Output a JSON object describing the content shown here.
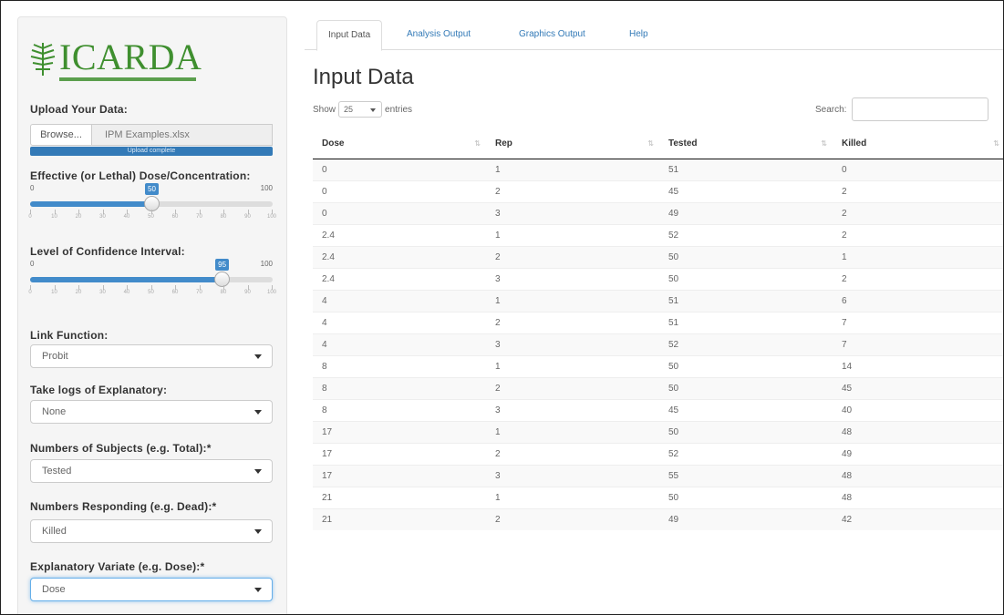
{
  "logo": {
    "text": "ICARDA"
  },
  "sidebar": {
    "upload_label": "Upload Your Data:",
    "browse_label": "Browse...",
    "file_name": "IPM Examples.xlsx",
    "upload_status": "Upload complete",
    "dose_label": "Effective (or Lethal) Dose/Concentration:",
    "dose_slider": {
      "min": "0",
      "max": "100",
      "value": "50",
      "value_fraction": 0.5,
      "tick_labels": [
        "0",
        "10",
        "20",
        "30",
        "40",
        "50",
        "60",
        "70",
        "80",
        "90",
        "100"
      ]
    },
    "ci_label": "Level of Confidence Interval:",
    "ci_slider": {
      "min": "0",
      "max": "100",
      "value": "95",
      "value_fraction": 0.79,
      "tick_labels": [
        "0",
        "10",
        "20",
        "30",
        "40",
        "50",
        "60",
        "70",
        "80",
        "90",
        "100"
      ]
    },
    "link_label": "Link Function:",
    "link_value": "Probit",
    "logs_label": "Take logs of Explanatory:",
    "logs_value": "None",
    "subjects_label": "Numbers of Subjects (e.g. Total):*",
    "subjects_value": "Tested",
    "responding_label": "Numbers Responding (e.g. Dead):*",
    "responding_value": "Killed",
    "explanatory_label": "Explanatory Variate (e.g. Dose):*",
    "explanatory_value": "Dose"
  },
  "tabs": [
    {
      "label": "Input Data",
      "active": true
    },
    {
      "label": "Analysis Output",
      "active": false
    },
    {
      "label": "Graphics Output",
      "active": false
    },
    {
      "label": "Help",
      "active": false
    }
  ],
  "main": {
    "title": "Input Data",
    "show_label": "Show",
    "entries_value": "25",
    "entries_label": "entries",
    "search_label": "Search:"
  },
  "table": {
    "columns": [
      "Dose",
      "Rep",
      "Tested",
      "Killed"
    ],
    "rows": [
      [
        "0",
        "1",
        "51",
        "0"
      ],
      [
        "0",
        "2",
        "45",
        "2"
      ],
      [
        "0",
        "3",
        "49",
        "2"
      ],
      [
        "2.4",
        "1",
        "52",
        "2"
      ],
      [
        "2.4",
        "2",
        "50",
        "1"
      ],
      [
        "2.4",
        "3",
        "50",
        "2"
      ],
      [
        "4",
        "1",
        "51",
        "6"
      ],
      [
        "4",
        "2",
        "51",
        "7"
      ],
      [
        "4",
        "3",
        "52",
        "7"
      ],
      [
        "8",
        "1",
        "50",
        "14"
      ],
      [
        "8",
        "2",
        "50",
        "45"
      ],
      [
        "8",
        "3",
        "45",
        "40"
      ],
      [
        "17",
        "1",
        "50",
        "48"
      ],
      [
        "17",
        "2",
        "52",
        "49"
      ],
      [
        "17",
        "3",
        "55",
        "48"
      ],
      [
        "21",
        "1",
        "50",
        "48"
      ],
      [
        "21",
        "2",
        "49",
        "42"
      ]
    ]
  },
  "colors": {
    "accent": "#337ab7",
    "slider": "#428bca",
    "logo": "#3f8f2f"
  }
}
